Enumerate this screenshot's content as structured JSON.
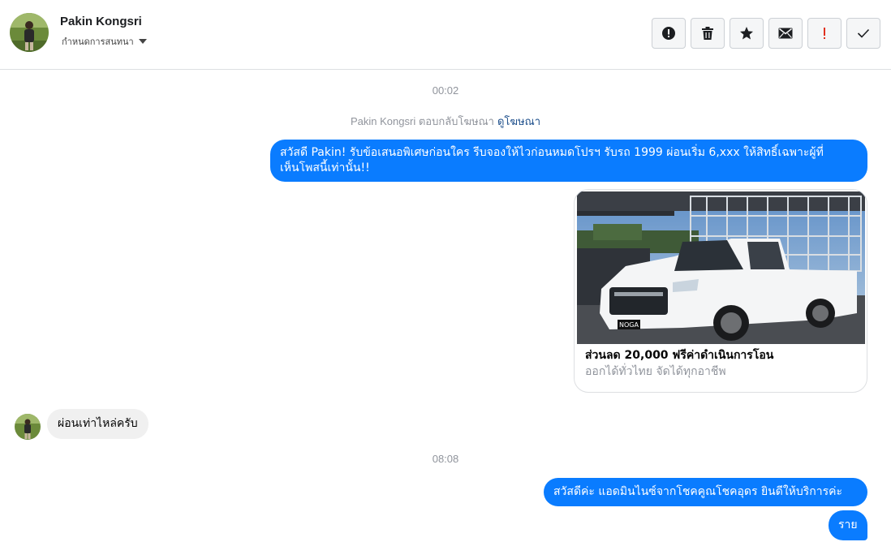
{
  "header": {
    "contact_name": "Pakin Kongsri",
    "assign_label": "กำหนดการสนทนา",
    "actions": [
      {
        "name": "spam-icon"
      },
      {
        "name": "trash-icon"
      },
      {
        "name": "star-icon"
      },
      {
        "name": "envelope-icon"
      },
      {
        "name": "exclamation-icon"
      },
      {
        "name": "check-icon"
      }
    ]
  },
  "thread": {
    "timestamp_1": "00:02",
    "reply_note": "Pakin Kongsri ตอบกลับโฆษณา",
    "reply_link": "ดูโฆษณา",
    "msg_out_1_line1": "สวัสดี Pakin! รับข้อเสนอพิเศษก่อนใคร รีบจองให้ไวก่อนหมดโปรฯ รับรถ 1999 ผ่อนเริ่ม 6,xxx ให้สิทธิ์เฉพาะผู้ที่",
    "msg_out_1_line2": "เห็นโพสนี้เท่านั้น!!",
    "card_title": "ส่วนลด 20,000 ฟรีค่าดำเนินการโอน",
    "card_subtitle": "ออกได้ทั่วไทย จัดได้ทุกอาชีพ",
    "card_plate": "NOGA",
    "msg_in_1": "ผ่อนเท่าไหล่ครับ",
    "timestamp_2": "08:08",
    "msg_out_2": "สวัสดีค่ะ แอดมินไนซ์จากโชคคูณโชคอุดร ยินดีให้บริการค่ะ",
    "msg_out_3": "ราย"
  },
  "colors": {
    "bubble_out": "#0a7cff",
    "bubble_in": "#f0f0f0",
    "muted_text": "#90949c",
    "link": "#1c4e8b",
    "exclamation": "#e0301e"
  }
}
